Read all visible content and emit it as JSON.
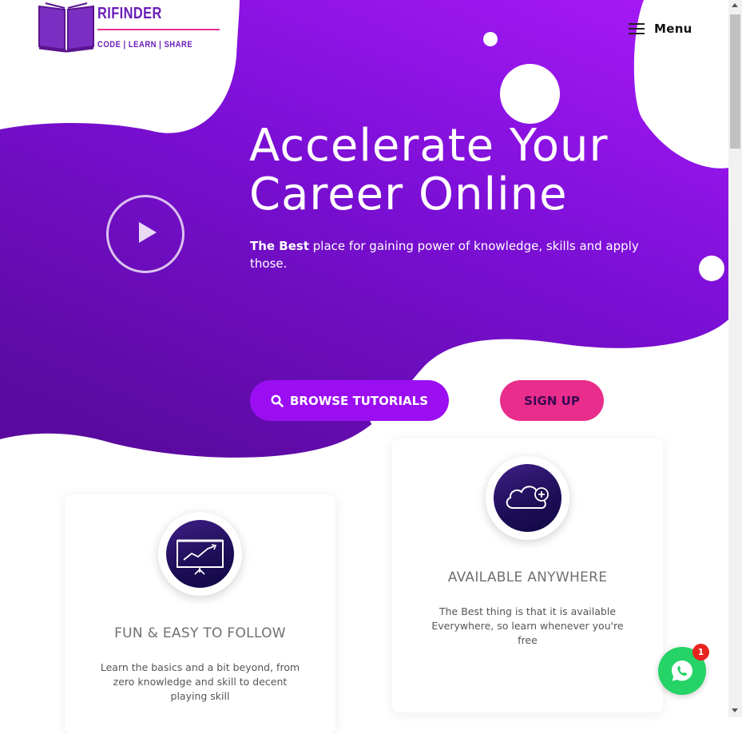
{
  "brand": {
    "name": "RIFINDER",
    "tagline": "CODE | LEARN | SHARE",
    "icon": "open-book-icon",
    "colors": {
      "primary": "#6a1db8",
      "accent": "#e8318f"
    }
  },
  "nav": {
    "menu_label": "Menu",
    "menu_icon": "hamburger-icon"
  },
  "hero": {
    "title": "Accelerate Your Career Online",
    "subtitle_bold": "The Best",
    "subtitle_rest": " place for gaining power of knowledge, skills and apply those.",
    "play_icon": "play-icon",
    "gradient": [
      "#9b14f0",
      "#5a0a9e"
    ]
  },
  "buttons": {
    "browse_label": "BROWSE TUTORIALS",
    "browse_icon": "search-icon",
    "browse_color": "#9b0ef2",
    "signup_label": "SIGN UP",
    "signup_color": "#e92d8c"
  },
  "features": [
    {
      "title": "FUN & EASY TO FOLLOW",
      "text": "Learn the basics and a bit beyond, from zero knowledge and skill to decent playing skill",
      "icon": "presentation-chart-icon"
    },
    {
      "title": "AVAILABLE ANYWHERE",
      "text": "The Best thing is that it is available Everywhere, so learn whenever you're free",
      "icon": "cloud-add-icon"
    }
  ],
  "whatsapp": {
    "badge_count": "1",
    "icon": "whatsapp-icon",
    "color": "#25d366"
  }
}
